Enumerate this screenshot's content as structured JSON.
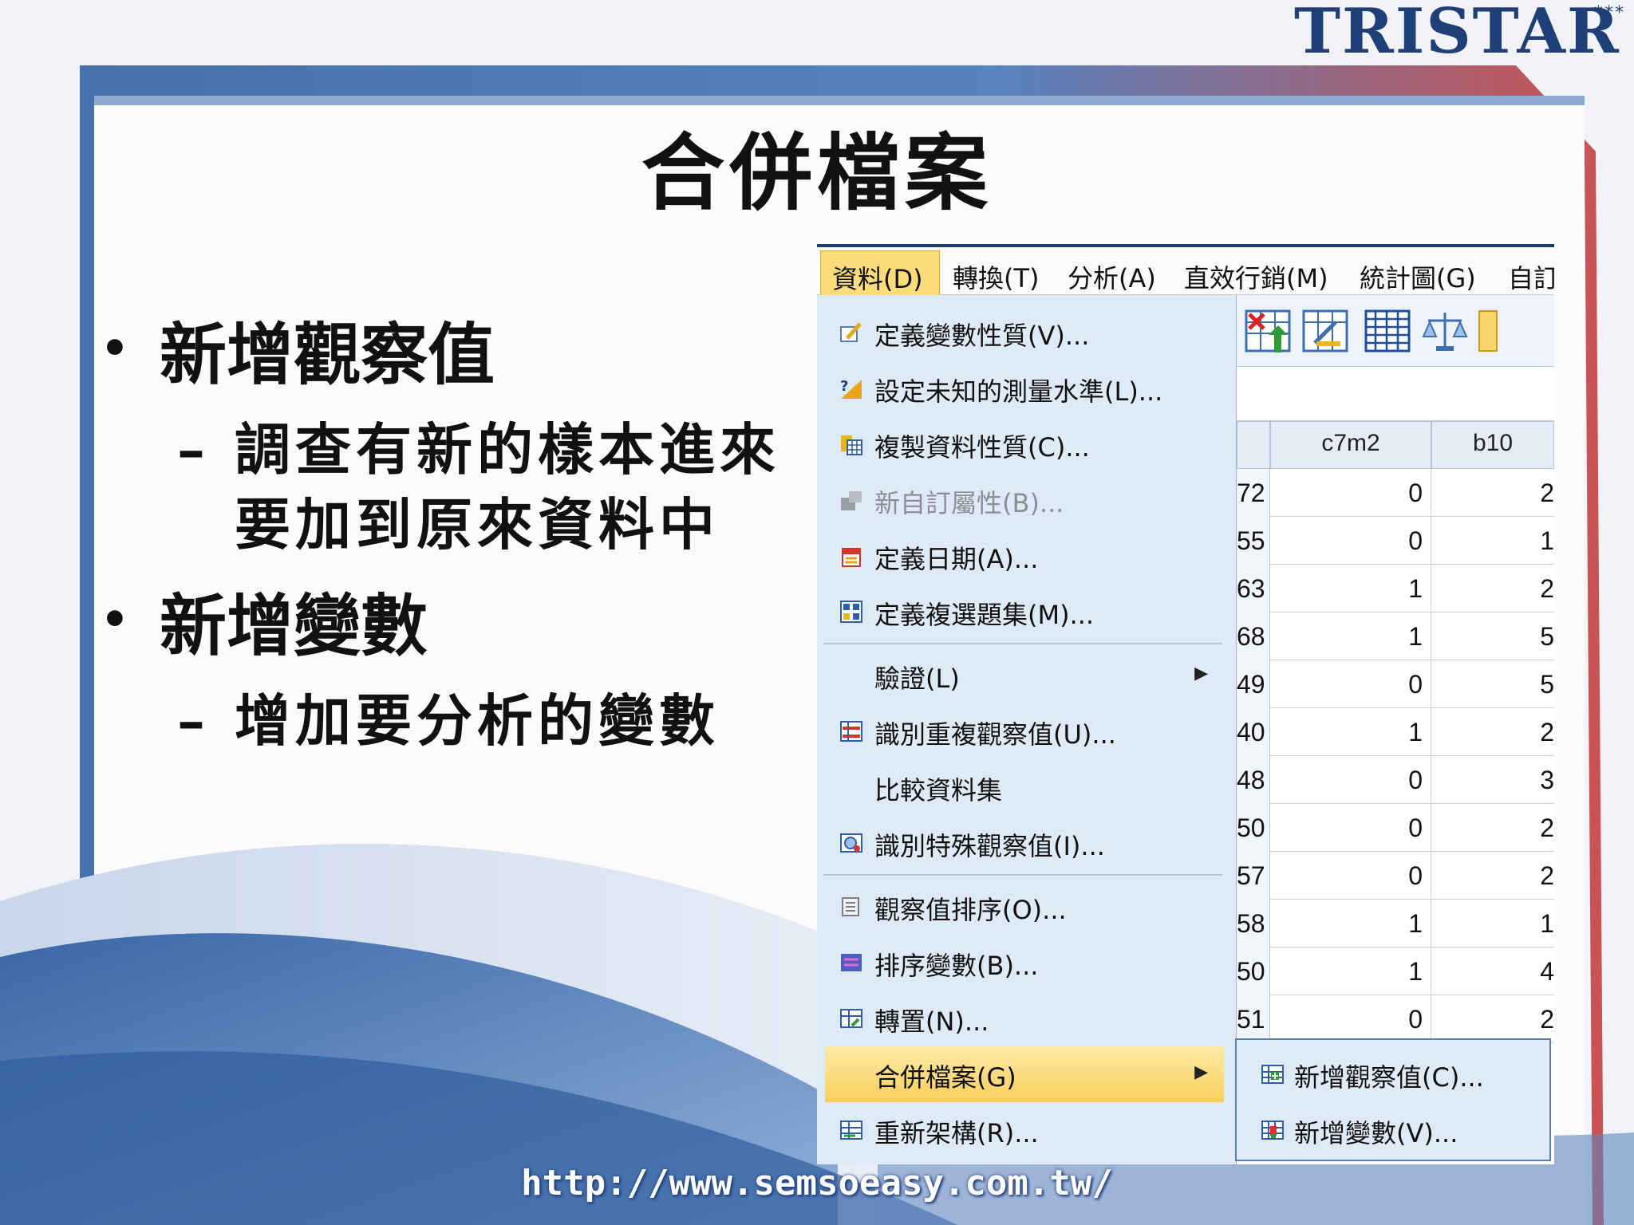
{
  "brand": {
    "logo_text": "TRISTAR",
    "logo_stars": "***"
  },
  "slide": {
    "title": "合併檔案",
    "bullets": [
      {
        "text": "新增觀察值",
        "sub_line1": "調查有新的樣本進來",
        "sub_line2": "要加到原來資料中"
      },
      {
        "text": "新增變數",
        "sub_line1": "增加要分析的變數"
      }
    ],
    "bullet_symbol": "•",
    "sub_symbol": "–",
    "url": "http://www.semsoeasy.com.tw/"
  },
  "spss": {
    "menubar": [
      "資料(D)",
      "轉換(T)",
      "分析(A)",
      "直效行銷(M)",
      "統計圖(G)",
      "自訂"
    ],
    "data_menu": [
      {
        "label": "定義變數性質(V)...",
        "icon": "define-variable-icon"
      },
      {
        "label": "設定未知的測量水準(L)...",
        "icon": "unknown-measure-icon"
      },
      {
        "label": "複製資料性質(C)...",
        "icon": "copy-data-properties-icon"
      },
      {
        "label": "新自訂屬性(B)...",
        "icon": "custom-attribute-icon",
        "disabled": true
      },
      {
        "label": "定義日期(A)...",
        "icon": "calendar-icon"
      },
      {
        "label": "定義複選題集(M)...",
        "icon": "multiple-response-icon"
      },
      {
        "label": "驗證(L)",
        "icon": "",
        "submenu": true
      },
      {
        "label": "識別重複觀察值(U)...",
        "icon": "duplicate-cases-icon"
      },
      {
        "label": "比較資料集",
        "icon": ""
      },
      {
        "label": "識別特殊觀察值(I)...",
        "icon": "unusual-cases-icon"
      },
      {
        "label": "觀察值排序(O)...",
        "icon": "sort-cases-icon"
      },
      {
        "label": "排序變數(B)...",
        "icon": "sort-variables-icon"
      },
      {
        "label": "轉置(N)...",
        "icon": "transpose-icon"
      },
      {
        "label": "合併檔案(G)",
        "icon": "",
        "submenu": true,
        "highlighted": true
      },
      {
        "label": "重新架構(R)...",
        "icon": "restructure-icon"
      }
    ],
    "merge_submenu": [
      {
        "label": "新增觀察值(C)...",
        "icon": "add-cases-icon"
      },
      {
        "label": "新增變數(V)...",
        "icon": "add-variables-icon"
      }
    ],
    "grid": {
      "columns": [
        "c7m2",
        "b10"
      ],
      "rows": [
        [
          "72",
          "0",
          "2"
        ],
        [
          "55",
          "0",
          "1"
        ],
        [
          "63",
          "1",
          "2"
        ],
        [
          "68",
          "1",
          "5"
        ],
        [
          "49",
          "0",
          "5"
        ],
        [
          "40",
          "1",
          "2"
        ],
        [
          "48",
          "0",
          "3"
        ],
        [
          "50",
          "0",
          "2"
        ],
        [
          "57",
          "0",
          "2"
        ],
        [
          "58",
          "1",
          "1"
        ],
        [
          "50",
          "1",
          "4"
        ],
        [
          "51",
          "0",
          "2"
        ]
      ]
    },
    "colors": {
      "highlight": "#f9cf5a",
      "menu_bg": "#dfeaf7",
      "accent": "#1b3a6b"
    }
  }
}
